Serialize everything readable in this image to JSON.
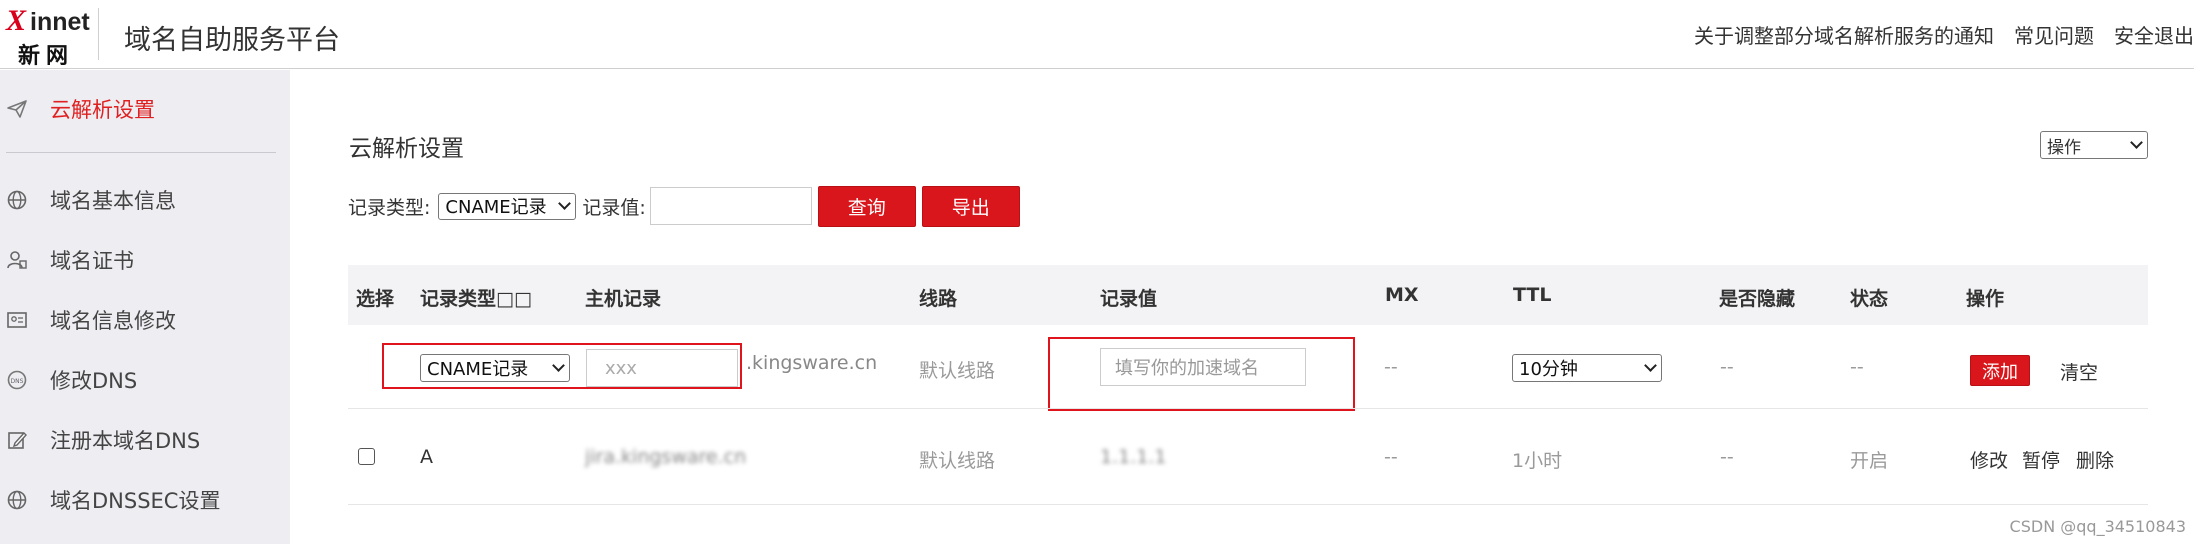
{
  "header": {
    "logo_mark": "X",
    "logo_word": "innet",
    "logo_cn": "新网",
    "platform_title": "域名自助服务平台",
    "links": [
      "关于调整部分域名解析服务的通知",
      "常见问题",
      "安全退出"
    ]
  },
  "sidebar": {
    "items": [
      {
        "label": "云解析设置",
        "icon": "send-icon",
        "active": true
      },
      {
        "label": "域名基本信息",
        "icon": "globe-icon"
      },
      {
        "label": "域名证书",
        "icon": "certificate-icon"
      },
      {
        "label": "域名信息修改",
        "icon": "id-card-icon"
      },
      {
        "label": "修改DNS",
        "icon": "dns-icon"
      },
      {
        "label": "注册本域名DNS",
        "icon": "edit-icon"
      },
      {
        "label": "域名DNSSEC设置",
        "icon": "globe-icon"
      }
    ]
  },
  "main": {
    "title": "云解析设置",
    "operation_select": "操作",
    "filter": {
      "type_label": "记录类型:",
      "type_value": "CNAME记录",
      "value_label": "记录值:",
      "value_input": "",
      "query_button": "查询",
      "export_button": "导出"
    },
    "table": {
      "headers": [
        "选择",
        "记录类型□□",
        "主机记录",
        "线路",
        "记录值",
        "MX",
        "TTL",
        "是否隐藏",
        "状态",
        "操作"
      ],
      "new_row": {
        "type": "CNAME记录",
        "host_placeholder": "xxx",
        "domain_suffix": ".kingsware.cn",
        "line": "默认线路",
        "value_placeholder": "填写你的加速域名",
        "mx": "--",
        "ttl": "10分钟",
        "hidden": "--",
        "status": "--",
        "add_button": "添加",
        "clear_button": "清空"
      },
      "rows": [
        {
          "type": "A",
          "host": "jira.kingsware.cn",
          "line": "默认线路",
          "value": "1.1.1.1",
          "mx": "--",
          "ttl": "1小时",
          "hidden": "--",
          "status": "开启",
          "actions": [
            "修改",
            "暂停",
            "删除"
          ]
        }
      ]
    }
  },
  "watermark": "CSDN @qq_34510843",
  "colors": {
    "accent": "#d9161c",
    "sidebar_bg": "#ededf2",
    "header_row_bg": "#f3f3f5"
  }
}
